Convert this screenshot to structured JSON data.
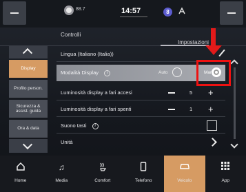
{
  "status_bar": {
    "station": "88.7",
    "time": "14:57",
    "profile_badge": "8",
    "icons": [
      "minus-icon",
      "radio-icon",
      "profile-icon",
      "antenna-icon",
      "minus-icon"
    ]
  },
  "header": {
    "left_title": "Controlli",
    "right_title": "Impostazioni"
  },
  "sidebar": {
    "items": [
      {
        "label": "Display",
        "active": true
      },
      {
        "label": "Profilo person.",
        "active": false
      },
      {
        "label": "Sicurezza & assist. guida",
        "active": false
      },
      {
        "label": "Ora & data",
        "active": false
      }
    ]
  },
  "rows": {
    "language": {
      "label": "Lingua   (Italiano (Italia))"
    },
    "display_mode": {
      "label": "Modalità Display",
      "option_auto": "Auto",
      "option_manual": "Manual"
    },
    "brightness_on": {
      "label": "Luminosità display a fari accesi",
      "value": "5"
    },
    "brightness_off": {
      "label": "Luminosità display a fari spenti",
      "value": "1"
    },
    "key_sound": {
      "label": "Suono tasti"
    },
    "units": {
      "label": "Unità"
    }
  },
  "bottom_nav": {
    "items": [
      {
        "label": "Home",
        "icon": "home-icon",
        "active": false
      },
      {
        "label": "Media",
        "icon": "music-note-icon",
        "active": false
      },
      {
        "label": "Comfort",
        "icon": "seat-heat-icon",
        "active": false
      },
      {
        "label": "Telefono",
        "icon": "phone-icon",
        "active": false
      },
      {
        "label": "Veicolo",
        "icon": "car-icon",
        "active": true
      },
      {
        "label": "App",
        "icon": "apps-grid-icon",
        "active": false
      }
    ]
  },
  "colors": {
    "accent": "#d69b63",
    "annotation_red": "#e21a1a"
  }
}
